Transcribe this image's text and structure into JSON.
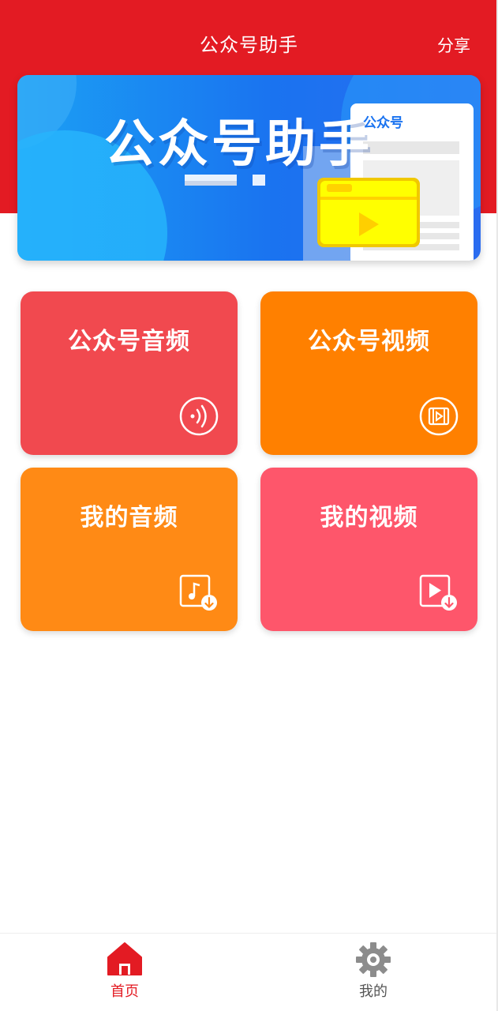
{
  "header": {
    "title": "公众号助手",
    "share_label": "分享"
  },
  "banner": {
    "title": "公众号助手",
    "doc_label": "公众号"
  },
  "tiles": [
    {
      "label": "公众号音频",
      "icon": "audio-wave-icon",
      "color": "#f1494f"
    },
    {
      "label": "公众号视频",
      "icon": "film-icon",
      "color": "#ff8000"
    },
    {
      "label": "我的音频",
      "icon": "music-download-icon",
      "color": "#ff8a15"
    },
    {
      "label": "我的视频",
      "icon": "video-download-icon",
      "color": "#fe566b"
    }
  ],
  "nav": {
    "items": [
      {
        "label": "首页",
        "icon": "home-icon",
        "active": true
      },
      {
        "label": "我的",
        "icon": "gear-icon",
        "active": false
      }
    ]
  },
  "colors": {
    "brand": "#e31b23",
    "nav_inactive": "#555555"
  }
}
